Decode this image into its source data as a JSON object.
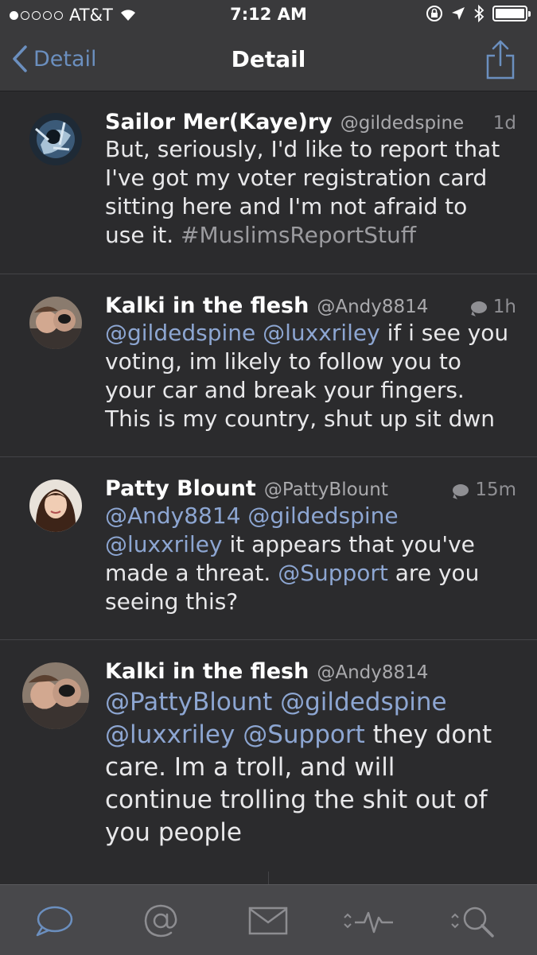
{
  "status_bar": {
    "carrier": "AT&T",
    "time": "7:12 AM",
    "signal_bars_filled": 1,
    "signal_bars_total": 5
  },
  "nav": {
    "back_label": "Detail",
    "title": "Detail"
  },
  "tweets": [
    {
      "name": "Sailor Mer(Kaye)ry",
      "handle": "@gildedspine",
      "time": "1d",
      "has_reply_icon": false,
      "lines": [
        [
          {
            "t": "But, seriously, I'd like to report that",
            "k": "text"
          }
        ],
        [
          {
            "t": "I've got my voter registration card",
            "k": "text"
          }
        ],
        [
          {
            "t": "sitting here and I'm not afraid to",
            "k": "text"
          }
        ],
        [
          {
            "t": "use it. ",
            "k": "text"
          },
          {
            "t": "#MuslimsReportStuff",
            "k": "hashtag"
          }
        ]
      ]
    },
    {
      "name": "Kalki in the flesh",
      "handle": "@Andy8814",
      "time": "1h",
      "has_reply_icon": true,
      "lines": [
        [
          {
            "t": "@gildedspine",
            "k": "mention"
          },
          {
            "t": " ",
            "k": "text"
          },
          {
            "t": "@luxxriley",
            "k": "mention"
          },
          {
            "t": " if i see you",
            "k": "text"
          }
        ],
        [
          {
            "t": "voting, im likely to follow you to",
            "k": "text"
          }
        ],
        [
          {
            "t": "your car and break your fingers.",
            "k": "text"
          }
        ],
        [
          {
            "t": "This is my country, shut up sit dwn",
            "k": "text"
          }
        ]
      ]
    },
    {
      "name": "Patty Blount",
      "handle": "@PattyBlount",
      "time": "15m",
      "has_reply_icon": true,
      "lines": [
        [
          {
            "t": "@Andy8814",
            "k": "mention"
          },
          {
            "t": " ",
            "k": "text"
          },
          {
            "t": "@gildedspine",
            "k": "mention"
          }
        ],
        [
          {
            "t": "@luxxriley",
            "k": "mention"
          },
          {
            "t": " it appears that you've",
            "k": "text"
          }
        ],
        [
          {
            "t": "made a threat. ",
            "k": "text"
          },
          {
            "t": "@Support",
            "k": "mention"
          },
          {
            "t": " are you",
            "k": "text"
          }
        ],
        [
          {
            "t": "seeing this?",
            "k": "text"
          }
        ]
      ]
    },
    {
      "name": "Kalki in the flesh",
      "handle": "@Andy8814",
      "time": "",
      "has_reply_icon": false,
      "lines": [
        [
          {
            "t": "@PattyBlount",
            "k": "mention"
          },
          {
            "t": " ",
            "k": "text"
          },
          {
            "t": "@gildedspine",
            "k": "mention"
          }
        ],
        [
          {
            "t": "@luxxriley",
            "k": "mention"
          },
          {
            "t": " ",
            "k": "text"
          },
          {
            "t": "@Support",
            "k": "mention"
          },
          {
            "t": " they dont",
            "k": "text"
          }
        ],
        [
          {
            "t": "care. Im a troll, and will",
            "k": "text"
          }
        ],
        [
          {
            "t": "continue trolling the shit out of",
            "k": "text"
          }
        ],
        [
          {
            "t": "you people",
            "k": "text"
          }
        ]
      ]
    }
  ],
  "tabs": [
    {
      "icon": "speech-bubble-icon",
      "active": true
    },
    {
      "icon": "at-sign-icon",
      "active": false
    },
    {
      "icon": "envelope-icon",
      "active": false
    },
    {
      "icon": "activity-icon",
      "active": false
    },
    {
      "icon": "search-icon",
      "active": false
    }
  ],
  "colors": {
    "accent": "#6b8fbf",
    "mention": "#8da6d2",
    "background": "#2b2b2d",
    "bar": "#3a3a3c"
  }
}
